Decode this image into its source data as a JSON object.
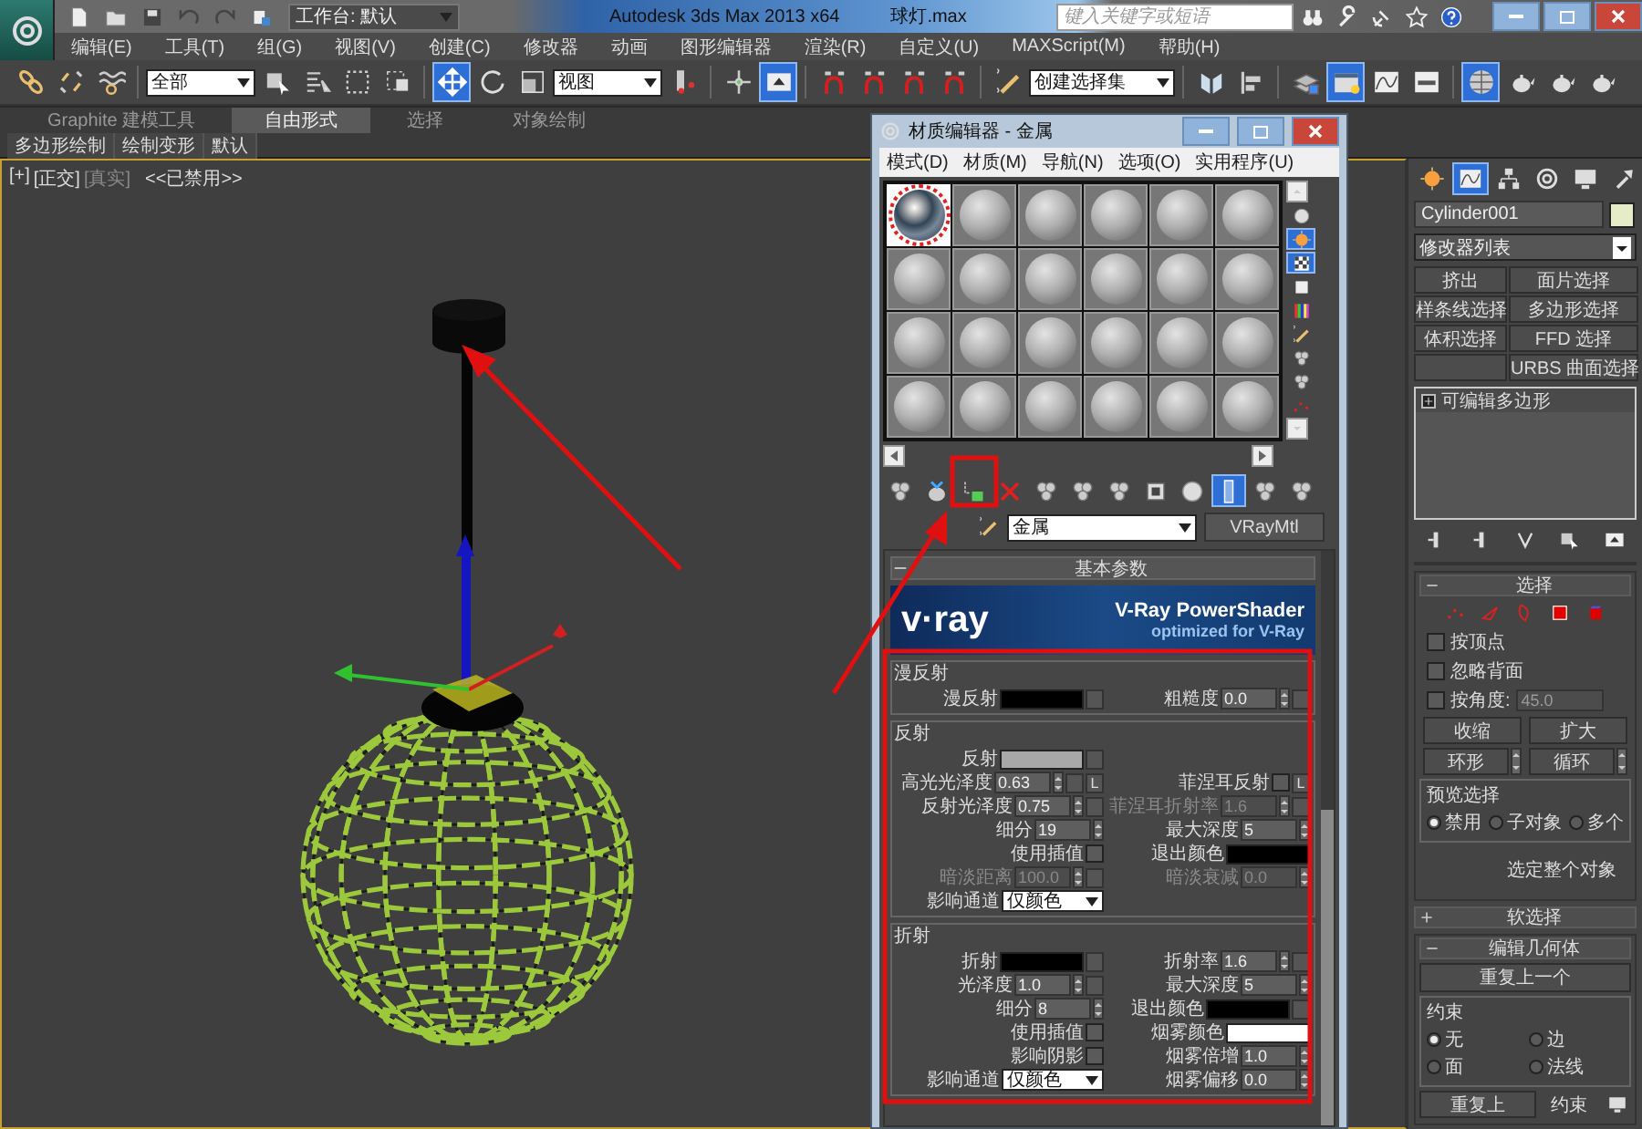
{
  "title_bar": {
    "workspace": "工作台: 默认",
    "app_title": "Autodesk 3ds Max  2013 x64",
    "file_name": "球灯.max",
    "search": {
      "placeholder": "键入关键字或短语"
    }
  },
  "menu": [
    "编辑(E)",
    "工具(T)",
    "组(G)",
    "视图(V)",
    "创建(C)",
    "修改器",
    "动画",
    "图形编辑器",
    "渲染(R)",
    "自定义(U)",
    "MAXScript(M)",
    "帮助(H)"
  ],
  "toolbar": [
    {
      "kind": "icon",
      "active": false
    },
    {
      "kind": "icon",
      "active": false
    },
    {
      "kind": "icon",
      "active": false
    },
    {
      "kind": "separator"
    },
    {
      "kind": "dropdown",
      "value": "全部"
    },
    {
      "kind": "icon",
      "active": false
    },
    {
      "kind": "icon",
      "active": false
    },
    {
      "kind": "icon",
      "active": false
    },
    {
      "kind": "icon",
      "active": false
    },
    {
      "kind": "separator"
    },
    {
      "kind": "icon",
      "active": true
    },
    {
      "kind": "icon",
      "active": false
    },
    {
      "kind": "icon",
      "active": false
    },
    {
      "kind": "dropdown",
      "value": "视图"
    },
    {
      "kind": "icon",
      "active": false
    },
    {
      "kind": "separator"
    },
    {
      "kind": "icon",
      "active": false
    },
    {
      "kind": "icon",
      "active": true
    },
    {
      "kind": "separator"
    },
    {
      "kind": "icon",
      "active": false
    },
    {
      "kind": "icon",
      "active": false
    },
    {
      "kind": "icon",
      "active": false
    },
    {
      "kind": "icon",
      "active": false
    },
    {
      "kind": "separator"
    },
    {
      "kind": "icon",
      "active": false
    },
    {
      "kind": "dropdown",
      "value": "创建选择集"
    },
    {
      "kind": "separator"
    },
    {
      "kind": "icon",
      "active": false
    },
    {
      "kind": "icon",
      "active": false
    },
    {
      "kind": "separator"
    },
    {
      "kind": "icon",
      "active": false
    },
    {
      "kind": "icon",
      "active": true
    },
    {
      "kind": "icon",
      "active": false
    },
    {
      "kind": "icon",
      "active": false
    },
    {
      "kind": "separator"
    },
    {
      "kind": "icon",
      "active": true
    },
    {
      "kind": "icon",
      "active": false
    },
    {
      "kind": "icon",
      "active": false
    },
    {
      "kind": "icon",
      "active": false
    }
  ],
  "ribbon": {
    "tabs": [
      {
        "label": "Graphite 建模工具",
        "selected": false
      },
      {
        "label": "自由形式",
        "selected": true
      },
      {
        "label": "选择",
        "selected": false
      },
      {
        "label": "对象绘制",
        "selected": false
      }
    ],
    "panels": [
      "多边形绘制",
      "绘制变形",
      "默认"
    ]
  },
  "viewport": {
    "labels": [
      {
        "text": "[+]",
        "dim": false
      },
      {
        "text": "[正交]",
        "dim": false
      },
      {
        "text": "[真实]",
        "dim": true
      },
      {
        "text": "<<已禁用>>",
        "dim": false
      }
    ]
  },
  "material_editor": {
    "title": "材质编辑器 - 金属",
    "menu": [
      "模式(D)",
      "材质(M)",
      "导航(N)",
      "选项(O)",
      "实用程序(U)"
    ],
    "slots": [
      {
        "kind": "textured",
        "selected": true
      },
      {
        "kind": "plain",
        "selected": false
      },
      {
        "kind": "plain",
        "selected": false
      },
      {
        "kind": "plain",
        "selected": false
      },
      {
        "kind": "plain",
        "selected": false
      },
      {
        "kind": "plain",
        "selected": false
      },
      {
        "kind": "plain",
        "selected": false
      },
      {
        "kind": "plain",
        "selected": false
      },
      {
        "kind": "plain",
        "selected": false
      },
      {
        "kind": "plain",
        "selected": false
      },
      {
        "kind": "plain",
        "selected": false
      },
      {
        "kind": "plain",
        "selected": false
      },
      {
        "kind": "plain",
        "selected": false
      },
      {
        "kind": "plain",
        "selected": false
      },
      {
        "kind": "plain",
        "selected": false
      },
      {
        "kind": "plain",
        "selected": false
      },
      {
        "kind": "plain",
        "selected": false
      },
      {
        "kind": "plain",
        "selected": false
      },
      {
        "kind": "plain",
        "selected": false
      },
      {
        "kind": "plain",
        "selected": false
      },
      {
        "kind": "plain",
        "selected": false
      },
      {
        "kind": "plain",
        "selected": false
      },
      {
        "kind": "plain",
        "selected": false
      },
      {
        "kind": "plain",
        "selected": false
      }
    ],
    "side_tools": [
      {
        "active": false
      },
      {
        "active": true
      },
      {
        "active": true
      },
      {
        "active": false
      },
      {
        "active": false
      },
      {
        "active": false
      },
      {
        "active": false
      },
      {
        "active": false
      },
      {
        "active": false
      }
    ],
    "tools": [
      {
        "active": false
      },
      {
        "active": false
      },
      {
        "active": false
      },
      {
        "active": false
      },
      {
        "active": false
      },
      {
        "active": false
      },
      {
        "active": false
      },
      {
        "active": false
      },
      {
        "active": false
      },
      {
        "active": true
      },
      {
        "active": false
      },
      {
        "active": false
      }
    ],
    "material_name": "金属",
    "material_type": "VRayMtl",
    "rollout": {
      "title": "基本参数",
      "expanded": true
    },
    "banner": {
      "logo": "v·ray",
      "title": "V-Ray PowerShader",
      "subtitle": "optimized for V-Ray"
    },
    "groups": [
      {
        "title": "漫反射",
        "rows": [
          {
            "left": {
              "label": "漫反射",
              "kind": "swatch",
              "color": "#000000",
              "disabled": false,
              "map_button": true
            },
            "right": {
              "label": "粗糙度",
              "kind": "spinner",
              "value": "0.0",
              "disabled": false,
              "map_button": true
            }
          }
        ]
      },
      {
        "title": "反射",
        "rows": [
          {
            "left": {
              "label": "反射",
              "kind": "swatch",
              "color": "#a8a8a8",
              "disabled": false,
              "map_button": true
            }
          },
          {
            "left": {
              "label": "高光光泽度",
              "kind": "spinner",
              "value": "0.63",
              "disabled": false,
              "map_button": true,
              "lock": "L"
            },
            "right": {
              "label": "菲涅耳反射",
              "kind": "checkbox",
              "checked": false,
              "disabled": false,
              "map_button": false,
              "lock": "L"
            }
          },
          {
            "left": {
              "label": "反射光泽度",
              "kind": "spinner",
              "value": "0.75",
              "disabled": false,
              "map_button": true
            },
            "right": {
              "label": "菲涅耳折射率",
              "kind": "spinner",
              "value": "1.6",
              "disabled": true,
              "map_button": true
            }
          },
          {
            "left": {
              "label": "细分",
              "kind": "spinner",
              "value": "19",
              "disabled": false,
              "map_button": false
            },
            "right": {
              "label": "最大深度",
              "kind": "spinner",
              "value": "5",
              "disabled": false,
              "map_button": false
            }
          },
          {
            "left": {
              "label": "使用插值",
              "kind": "checkbox",
              "checked": false,
              "disabled": false,
              "map_button": false
            },
            "right": {
              "label": "退出颜色",
              "kind": "swatch",
              "color": "#000000",
              "disabled": false,
              "map_button": false
            }
          },
          {
            "left": {
              "label": "暗淡距离",
              "kind": "spinner",
              "value": "100.0",
              "disabled": true,
              "map_button": true
            },
            "right": {
              "label": "暗淡衰减",
              "kind": "spinner",
              "value": "0.0",
              "disabled": true,
              "map_button": false
            }
          },
          {
            "left": {
              "label": "影响通道",
              "kind": "dropdown",
              "value": "仅颜色",
              "disabled": false,
              "map_button": false
            }
          }
        ]
      },
      {
        "title": "折射",
        "rows": [
          {
            "left": {
              "label": "折射",
              "kind": "swatch",
              "color": "#000000",
              "disabled": false,
              "map_button": true
            },
            "right": {
              "label": "折射率",
              "kind": "spinner",
              "value": "1.6",
              "disabled": false,
              "map_button": true
            }
          },
          {
            "left": {
              "label": "光泽度",
              "kind": "spinner",
              "value": "1.0",
              "disabled": false,
              "map_button": true
            },
            "right": {
              "label": "最大深度",
              "kind": "spinner",
              "value": "5",
              "disabled": false,
              "map_button": false
            }
          },
          {
            "left": {
              "label": "细分",
              "kind": "spinner",
              "value": "8",
              "disabled": false,
              "map_button": false
            },
            "right": {
              "label": "退出颜色",
              "kind": "swatch",
              "color": "#000000",
              "disabled": false,
              "map_button": true
            }
          },
          {
            "left": {
              "label": "使用插值",
              "kind": "checkbox",
              "checked": false,
              "disabled": false,
              "map_button": false
            },
            "right": {
              "label": "烟雾颜色",
              "kind": "swatch",
              "color": "#ffffff",
              "disabled": false,
              "map_button": false
            }
          },
          {
            "left": {
              "label": "影响阴影",
              "kind": "checkbox",
              "checked": false,
              "disabled": false,
              "map_button": false
            },
            "right": {
              "label": "烟雾倍增",
              "kind": "spinner",
              "value": "1.0",
              "disabled": false,
              "map_button": false
            }
          },
          {
            "left": {
              "label": "影响通道",
              "kind": "dropdown",
              "value": "仅颜色",
              "disabled": false,
              "map_button": false
            },
            "right": {
              "label": "烟雾偏移",
              "kind": "spinner",
              "value": "0.0",
              "disabled": false,
              "map_button": false
            }
          }
        ]
      }
    ]
  },
  "command_panel": {
    "tabs": [
      {
        "selected": false
      },
      {
        "selected": true
      },
      {
        "selected": false
      },
      {
        "selected": false
      },
      {
        "selected": false
      },
      {
        "selected": false
      }
    ],
    "object_name": "Cylinder001",
    "modifier_list": "修改器列表",
    "modifier_buttons": [
      {
        "kind": "button",
        "label": "挤出"
      },
      {
        "kind": "button",
        "label": "面片选择"
      },
      {
        "kind": "button",
        "label": "样条线选择"
      },
      {
        "kind": "button",
        "label": "多边形选择"
      },
      {
        "kind": "button",
        "label": "体积选择"
      },
      {
        "kind": "button",
        "label": "FFD 选择"
      },
      {
        "kind": "blank"
      },
      {
        "kind": "button",
        "label": "URBS 曲面选择"
      }
    ],
    "stack": [
      {
        "label": "可编辑多边形",
        "expanded": false
      }
    ],
    "selection": {
      "title": "选择",
      "expanded": true,
      "checkboxes": [
        {
          "label": "按顶点",
          "checked": false
        },
        {
          "label": "忽略背面",
          "checked": false
        },
        {
          "label": "按角度:",
          "checked": false
        }
      ],
      "angle": "45.0",
      "buttons": [
        "收缩",
        "扩大"
      ],
      "spin_buttons": [
        "环形",
        "循环"
      ],
      "preview": {
        "title": "预览选择",
        "options": [
          {
            "label": "禁用",
            "selected": true
          },
          {
            "label": "子对象",
            "selected": false
          },
          {
            "label": "多个",
            "selected": false
          }
        ]
      },
      "note": "选定整个对象"
    },
    "soft_selection": {
      "title": "软选择",
      "expanded": false
    },
    "edit_geometry": {
      "title": "编辑几何体",
      "expanded": true,
      "repeat_button": "重复上一个",
      "constraints": {
        "title": "约束",
        "options": [
          {
            "label": "无",
            "selected": true
          },
          {
            "label": "边",
            "selected": false
          },
          {
            "label": "面",
            "selected": false
          },
          {
            "label": "法线",
            "selected": false
          }
        ]
      },
      "overlap_button": "重复上",
      "overlap_group": "约束"
    }
  }
}
